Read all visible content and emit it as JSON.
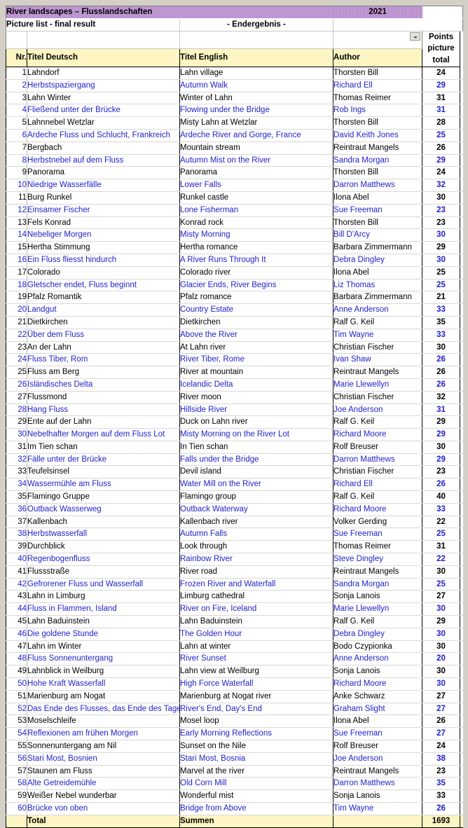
{
  "header": {
    "title": "River landscapes – Flusslandschaften",
    "year": "2021",
    "subtitle_left": "Picture list - final result",
    "subtitle_mid": "- Endergebnis -",
    "filter_icon": "chevron-down-icon"
  },
  "columns": {
    "nr": "Nr.",
    "title_de": "Titel Deutsch",
    "title_en": "Titel English",
    "author": "Author",
    "points": "Points picture total",
    "points_line1": "Points",
    "points_line2": "picture",
    "points_line3": "total"
  },
  "total": {
    "label_en": "Total",
    "label_de": "Summen",
    "author": "",
    "points": "1693"
  },
  "colors": {
    "header_fill": "#fdf5c2",
    "title_band": "#e8d9ef",
    "blue_text": "#2222cc",
    "black_text": "#000000",
    "page_bg": "#d4d0c8"
  },
  "rows": [
    {
      "nr": "1",
      "de": "Lahndorf",
      "en": "Lahn village",
      "author": "Thorsten Bill",
      "points": "24",
      "color": "black"
    },
    {
      "nr": "2",
      "de": "Herbstspaziergang",
      "en": "Autumn Walk",
      "author": "Richard Ell",
      "points": "29",
      "color": "blue"
    },
    {
      "nr": "3",
      "de": "Lahn Winter",
      "en": "Winter of Lahn",
      "author": "Thomas Reimer",
      "points": "31",
      "color": "black"
    },
    {
      "nr": "4",
      "de": "Fließend unter der Brücke",
      "en": "Flowing under the Bridge",
      "author": "Rob Ings",
      "points": "31",
      "color": "blue"
    },
    {
      "nr": "5",
      "de": "Lahnnebel Wetzlar",
      "en": "Misty Lahn at Wetzlar",
      "author": "Thorsten Bill",
      "points": "28",
      "color": "black"
    },
    {
      "nr": "6",
      "de": "Ardeche Fluss und Schlucht, Frankreich",
      "en": "Ardeche River and Gorge, France",
      "author": "David Keith Jones",
      "points": "25",
      "color": "blue"
    },
    {
      "nr": "7",
      "de": "Bergbach",
      "en": "Mountain stream",
      "author": "Reintraut Mangels",
      "points": "26",
      "color": "black"
    },
    {
      "nr": "8",
      "de": "Herbstnebel auf dem Fluss",
      "en": "Autumn Mist on the River",
      "author": "Sandra Morgan",
      "points": "29",
      "color": "blue"
    },
    {
      "nr": "9",
      "de": "Panorama",
      "en": "Panorama",
      "author": "Thorsten Bill",
      "points": "24",
      "color": "black"
    },
    {
      "nr": "10",
      "de": "Niedrige Wasserfälle",
      "en": "Lower Falls",
      "author": "Darron Matthews",
      "points": "32",
      "color": "blue"
    },
    {
      "nr": "11",
      "de": "Burg Runkel",
      "en": "Runkel castle",
      "author": "Ilona Abel",
      "points": "30",
      "color": "black"
    },
    {
      "nr": "12",
      "de": "Einsamer Fischer",
      "en": "Lone Fisherman",
      "author": "Sue Freeman",
      "points": "23",
      "color": "blue"
    },
    {
      "nr": "13",
      "de": "Fels Konrad",
      "en": "Konrad rock",
      "author": "Thorsten Bill",
      "points": "23",
      "color": "black"
    },
    {
      "nr": "14",
      "de": "Nebeliger Morgen",
      "en": "Misty Morning",
      "author": "Bill D'Arcy",
      "points": "30",
      "color": "blue"
    },
    {
      "nr": "15",
      "de": "Hertha Stimmung",
      "en": "Hertha romance",
      "author": "Barbara Zimmermann",
      "points": "29",
      "color": "black"
    },
    {
      "nr": "16",
      "de": "Ein Fluss fliesst hindurch",
      "en": "A River Runs Through It",
      "author": "Debra Dingley",
      "points": "30",
      "color": "blue"
    },
    {
      "nr": "17",
      "de": "Colorado",
      "en": "Colorado river",
      "author": "Ilona Abel",
      "points": "25",
      "color": "black"
    },
    {
      "nr": "18",
      "de": "Gletscher endet, Fluss beginnt",
      "en": "Glacier Ends, River Begins",
      "author": "Liz Thomas",
      "points": "25",
      "color": "blue"
    },
    {
      "nr": "19",
      "de": "Pfalz Romantik",
      "en": "Pfalz romance",
      "author": "Barbara Zimmermann",
      "points": "21",
      "color": "black"
    },
    {
      "nr": "20",
      "de": "Landgut",
      "en": "Country Estate",
      "author": "Anne Anderson",
      "points": "33",
      "color": "blue"
    },
    {
      "nr": "21",
      "de": "Dietkirchen",
      "en": "Dietkirchen",
      "author": "Ralf G. Keil",
      "points": "35",
      "color": "black"
    },
    {
      "nr": "22",
      "de": "Über dem Fluss",
      "en": "Above the River",
      "author": "Tim Wayne",
      "points": "33",
      "color": "blue"
    },
    {
      "nr": "23",
      "de": "An der Lahn",
      "en": "At Lahn river",
      "author": "Christian Fischer",
      "points": "30",
      "color": "black"
    },
    {
      "nr": "24",
      "de": "Fluss Tiber, Rom",
      "en": "River Tiber, Rome",
      "author": "Ivan Shaw",
      "points": "26",
      "color": "blue"
    },
    {
      "nr": "25",
      "de": "Fluss am Berg",
      "en": "River at mountain",
      "author": "Reintraut Mangels",
      "points": "26",
      "color": "black"
    },
    {
      "nr": "26",
      "de": "Isländisches Delta",
      "en": "Icelandic Delta",
      "author": "Marie Llewellyn",
      "points": "26",
      "color": "blue"
    },
    {
      "nr": "27",
      "de": "Flussmond",
      "en": "River moon",
      "author": "Christian Fischer",
      "points": "32",
      "color": "black"
    },
    {
      "nr": "28",
      "de": "Hang Fluss",
      "en": "Hillside River",
      "author": "Joe Anderson",
      "points": "31",
      "color": "blue"
    },
    {
      "nr": "29",
      "de": "Ente auf der Lahn",
      "en": "Duck on Lahn river",
      "author": "Ralf G. Keil",
      "points": "29",
      "color": "black"
    },
    {
      "nr": "30",
      "de": "Nebelhafter Morgen auf dem Fluss Lot",
      "en": "Misty Morning on the River Lot",
      "author": "Richard Moore",
      "points": "29",
      "color": "blue"
    },
    {
      "nr": "31",
      "de": "Im Tien schan",
      "en": "In Tien schan",
      "author": "Rolf Breuser",
      "points": "30",
      "color": "black"
    },
    {
      "nr": "32",
      "de": "Fälle unter der Brücke",
      "en": "Falls under the Bridge",
      "author": "Darron Matthews",
      "points": "29",
      "color": "blue"
    },
    {
      "nr": "33",
      "de": "Teufelsinsel",
      "en": "Devil island",
      "author": "Christian Fischer",
      "points": "23",
      "color": "black"
    },
    {
      "nr": "34",
      "de": "Wassermühle am Fluss",
      "en": "Water Mill on the River",
      "author": "Richard Ell",
      "points": "26",
      "color": "blue"
    },
    {
      "nr": "35",
      "de": "Flamingo Gruppe",
      "en": "Flamingo group",
      "author": "Ralf G. Keil",
      "points": "40",
      "color": "black"
    },
    {
      "nr": "36",
      "de": "Outback Wasserweg",
      "en": "Outback Waterway",
      "author": "Richard Moore",
      "points": "33",
      "color": "blue"
    },
    {
      "nr": "37",
      "de": "Kallenbach",
      "en": "Kallenbach river",
      "author": "Volker Gerding",
      "points": "22",
      "color": "black"
    },
    {
      "nr": "38",
      "de": "Herbstwasserfall",
      "en": "Autumn Falls",
      "author": "Sue Freeman",
      "points": "25",
      "color": "blue"
    },
    {
      "nr": "39",
      "de": "Durchblick",
      "en": "Look through",
      "author": "Thomas Reimer",
      "points": "31",
      "color": "black"
    },
    {
      "nr": "40",
      "de": "Regenbogenfluss",
      "en": "Rainbow River",
      "author": "Steve Dingley",
      "points": "22",
      "color": "blue"
    },
    {
      "nr": "41",
      "de": "Flussstraße",
      "en": "River road",
      "author": "Reintraut Mangels",
      "points": "30",
      "color": "black"
    },
    {
      "nr": "42",
      "de": "Gefrorener Fluss und Wasserfall",
      "en": "Frozen River and Waterfall",
      "author": "Sandra Morgan",
      "points": "25",
      "color": "blue"
    },
    {
      "nr": "43",
      "de": "Lahn in Limburg",
      "en": "Limburg cathedral",
      "author": "Sonja Lanois",
      "points": "27",
      "color": "black"
    },
    {
      "nr": "44",
      "de": "Fluss in Flammen, Island",
      "en": "River on Fire, Iceland",
      "author": "Marie Llewellyn",
      "points": "30",
      "color": "blue"
    },
    {
      "nr": "45",
      "de": "Lahn Baduinstein",
      "en": "Lahn Baduinstein",
      "author": "Ralf G. Keil",
      "points": "29",
      "color": "black"
    },
    {
      "nr": "46",
      "de": "Die goldene Stunde",
      "en": "The Golden Hour",
      "author": "Debra Dingley",
      "points": "30",
      "color": "blue"
    },
    {
      "nr": "47",
      "de": "Lahn im Winter",
      "en": "Lahn at winter",
      "author": "Bodo Czypionka",
      "points": "30",
      "color": "black"
    },
    {
      "nr": "48",
      "de": "Fluss Sonnenuntergang",
      "en": "River Sunset",
      "author": "Anne Anderson",
      "points": "20",
      "color": "blue"
    },
    {
      "nr": "49",
      "de": "Lahnblick in Weilburg",
      "en": "Lahn view at Weilburg",
      "author": "Sonja Lanois",
      "points": "30",
      "color": "black"
    },
    {
      "nr": "50",
      "de": "Hohe Kraft Wasserfall",
      "en": "High Force Waterfall",
      "author": "Richard Moore",
      "points": "30",
      "color": "blue"
    },
    {
      "nr": "51",
      "de": "Marienburg am Nogat",
      "en": "Marienburg at Nogat river",
      "author": "Anke Schwarz",
      "points": "27",
      "color": "black"
    },
    {
      "nr": "52",
      "de": "Das Ende des Flusses, das Ende des Tages",
      "en": "River's End, Day's End",
      "author": "Graham Slight",
      "points": "27",
      "color": "blue"
    },
    {
      "nr": "53",
      "de": "Moselschleife",
      "en": "Mosel loop",
      "author": "Ilona Abel",
      "points": "26",
      "color": "black"
    },
    {
      "nr": "54",
      "de": "Reflexionen am frühen Morgen",
      "en": "Early Morning Reflections",
      "author": "Sue Freeman",
      "points": "27",
      "color": "blue"
    },
    {
      "nr": "55",
      "de": "Sonnenuntergang am Nil",
      "en": "Sunset on the Nile",
      "author": "Rolf Breuser",
      "points": "24",
      "color": "black"
    },
    {
      "nr": "56",
      "de": "Stari Most, Bosnien",
      "en": "Stari Most, Bosnia",
      "author": "Joe Anderson",
      "points": "38",
      "color": "blue"
    },
    {
      "nr": "57",
      "de": "Staunen am Fluss",
      "en": "Marvel at the river",
      "author": "Reintraut Mangels",
      "points": "23",
      "color": "black"
    },
    {
      "nr": "58",
      "de": "Alte Getreidemühle",
      "en": "Old Corn Mill",
      "author": "Darron Matthews",
      "points": "35",
      "color": "blue"
    },
    {
      "nr": "59",
      "de": "Weißer Nebel wunderbar",
      "en": "Wonderful mist",
      "author": "Sonja Lanois",
      "points": "33",
      "color": "black"
    },
    {
      "nr": "60",
      "de": "Brücke von oben",
      "en": "Bridge from Above",
      "author": "Tim Wayne",
      "points": "26",
      "color": "blue"
    }
  ]
}
